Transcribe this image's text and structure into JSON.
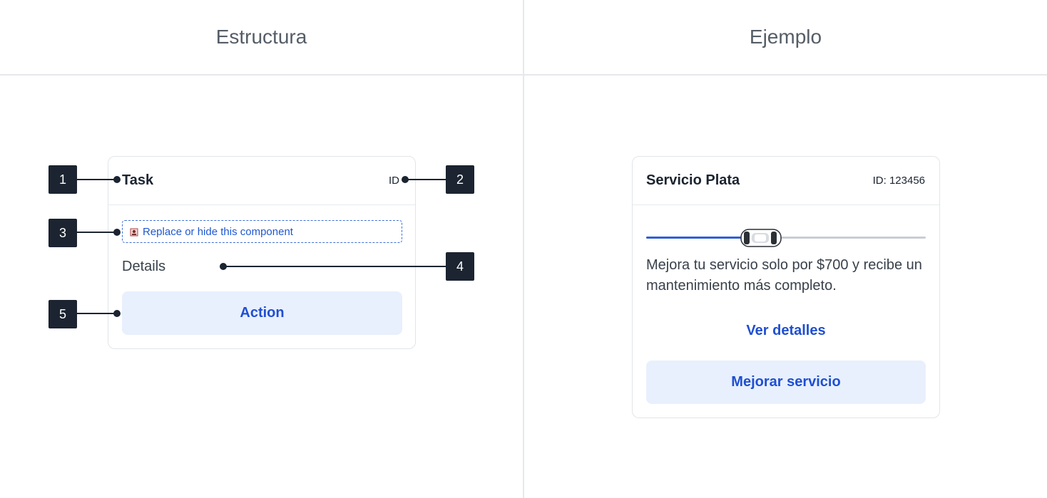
{
  "columns": {
    "structure_title": "Estructura",
    "example_title": "Ejemplo"
  },
  "structure_card": {
    "title": "Task",
    "id_label": "ID",
    "placeholder_text": "Replace or hide this component",
    "details": "Details",
    "action_label": "Action"
  },
  "markers": [
    "1",
    "2",
    "3",
    "4",
    "5"
  ],
  "example_card": {
    "title": "Servicio Plata",
    "id_label": "ID: 123456",
    "progress": 0.41,
    "description_line1": "Mejora tu servicio solo por $700 y recibe un",
    "description_line2": "mantenimiento más completo.",
    "link_label": "Ver detalles",
    "button_label": "Mejorar servicio"
  },
  "colors": {
    "accent": "#1f4fd1",
    "button_bg": "#e8f0fd",
    "marker_bg": "#1b2430",
    "track_active": "#2f5fd6",
    "track_inactive": "#c9cdd3"
  },
  "icons": {
    "placeholder": "component-placeholder-icon",
    "slider_thumb": "car-icon"
  }
}
